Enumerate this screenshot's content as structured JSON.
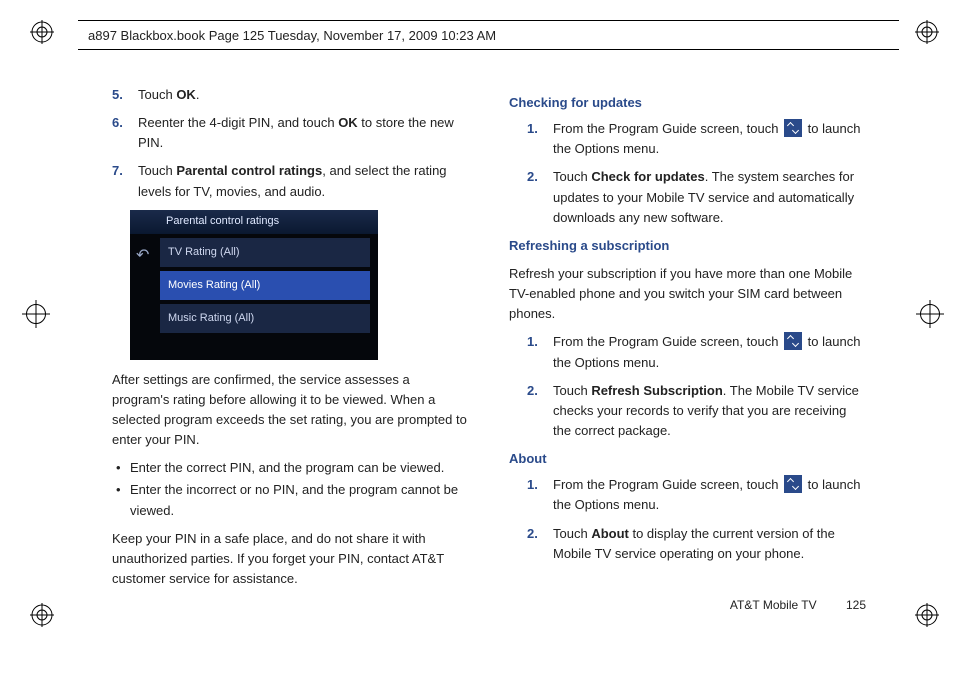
{
  "header": {
    "text": "a897 Blackbox.book  Page 125  Tuesday, November 17, 2009  10:23 AM"
  },
  "left": {
    "items": [
      {
        "n": "5.",
        "pre": "Touch ",
        "b": "OK",
        "post": "."
      },
      {
        "n": "6.",
        "pre": "Reenter the 4-digit PIN, and touch ",
        "b": "OK",
        "post": " to store the new PIN."
      },
      {
        "n": "7.",
        "pre": "Touch ",
        "b": "Parental control ratings",
        "post": ", and select the rating levels for TV, movies, and audio."
      }
    ],
    "screenshot": {
      "title": "Parental control ratings",
      "rows": [
        "TV Rating (All)",
        "Movies Rating (All)",
        "Music Rating (All)"
      ],
      "selected_index": 1
    },
    "after_p1": "After settings are confirmed, the service assesses a program's rating before allowing it to be viewed. When a selected program exceeds the set rating, you are prompted to enter your PIN.",
    "bullets": [
      "Enter the correct PIN, and the program can be viewed.",
      "Enter the incorrect or no PIN, and the program cannot be viewed."
    ],
    "after_p2": "Keep your PIN in a safe place, and do not share it with unauthorized parties. If you forget your PIN, contact AT&T customer service for assistance."
  },
  "right": {
    "sections": [
      {
        "heading": "Checking for updates",
        "items": [
          {
            "n": "1.",
            "pre": "From the Program Guide screen, touch ",
            "icon": true,
            "post": " to launch the Options menu."
          },
          {
            "n": "2.",
            "pre": "Touch ",
            "b": "Check for updates",
            "post": ". The system searches for updates to your Mobile TV service and automatically downloads any new software."
          }
        ]
      },
      {
        "heading": "Refreshing a subscription",
        "intro": "Refresh your subscription if you have more than one Mobile TV-enabled phone and you switch your SIM card between phones.",
        "items": [
          {
            "n": "1.",
            "pre": "From the Program Guide screen, touch ",
            "icon": true,
            "post": " to launch the Options menu."
          },
          {
            "n": "2.",
            "pre": "Touch ",
            "b": "Refresh Subscription",
            "post": ". The Mobile TV service checks your records to verify that you are receiving the correct package."
          }
        ]
      },
      {
        "heading": "About",
        "items": [
          {
            "n": "1.",
            "pre": "From the Program Guide screen, touch ",
            "icon": true,
            "post": " to launch the Options menu."
          },
          {
            "n": "2.",
            "pre": "Touch ",
            "b": "About",
            "post": " to display the current version of the Mobile TV service operating on your phone."
          }
        ]
      }
    ]
  },
  "footer": {
    "section": "AT&T Mobile TV",
    "page": "125"
  }
}
